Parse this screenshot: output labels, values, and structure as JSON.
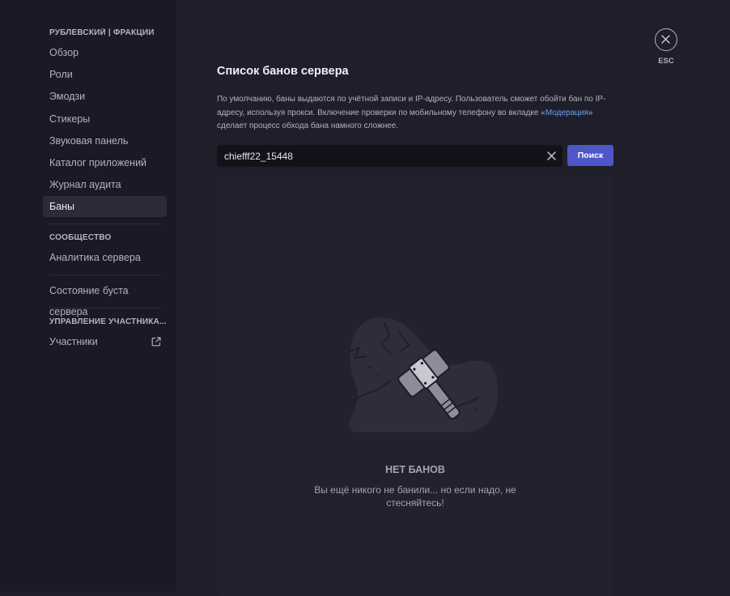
{
  "sidebar": {
    "server_section": "РУБЛЕВСКИЙ | ФРАКЦИИ",
    "items": [
      {
        "label": "Обзор"
      },
      {
        "label": "Роли"
      },
      {
        "label": "Эмодзи"
      },
      {
        "label": "Стикеры"
      },
      {
        "label": "Звуковая панель"
      },
      {
        "label": "Каталог приложений"
      },
      {
        "label": "Журнал аудита"
      },
      {
        "label": "Баны"
      }
    ],
    "community_section": "СООБЩЕСТВО",
    "community_items": [
      {
        "label": "Аналитика сервера"
      }
    ],
    "boost_item": "Состояние буста сервера",
    "members_section": "УПРАВЛЕНИЕ УЧАСТНИКА...",
    "members_item": "Участники",
    "active_item": "Баны"
  },
  "main": {
    "title": "Список банов сервера",
    "description_1": "По умолчанию, баны выдаются по учётной записи и IP-адресу. Пользователь сможет обойти бан по IP-адресу, используя прокси. Включение проверки по мобильному телефону во вкладке «",
    "description_link": "Модерация",
    "description_2": "» сделает процесс обхода бана намного сложнее.",
    "search_value": "chiefff22_15448",
    "search_button": "Поиск",
    "empty_title": "НЕТ БАНОВ",
    "empty_subtitle": "Вы ещё никого не банили... но если надо, не стесняйтесь!"
  },
  "close": {
    "label": "ESC",
    "icon": "close-icon"
  },
  "colors": {
    "accent": "#4f56c8",
    "link": "#6aa4f5",
    "sidebar_bg": "#1a1925",
    "main_bg": "#1f1e2b"
  }
}
